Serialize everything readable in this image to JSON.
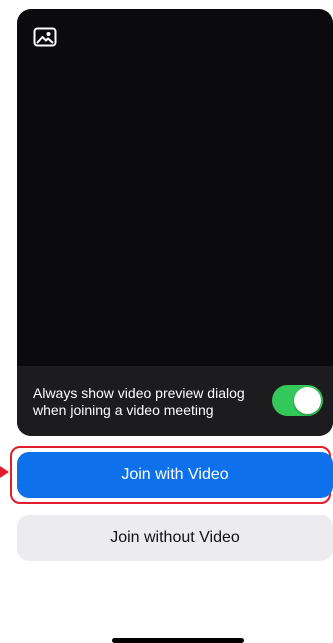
{
  "preview": {
    "background_icon": "image-icon",
    "footer_line1": "Always show video preview dialog",
    "footer_line2": "when joining a video meeting",
    "toggle_state": "on"
  },
  "buttons": {
    "join_with_video": "Join with Video",
    "join_without_video": "Join without Video"
  },
  "colors": {
    "primary": "#0e71eb",
    "toggle_on": "#34c759",
    "highlight": "#e11d2b"
  }
}
